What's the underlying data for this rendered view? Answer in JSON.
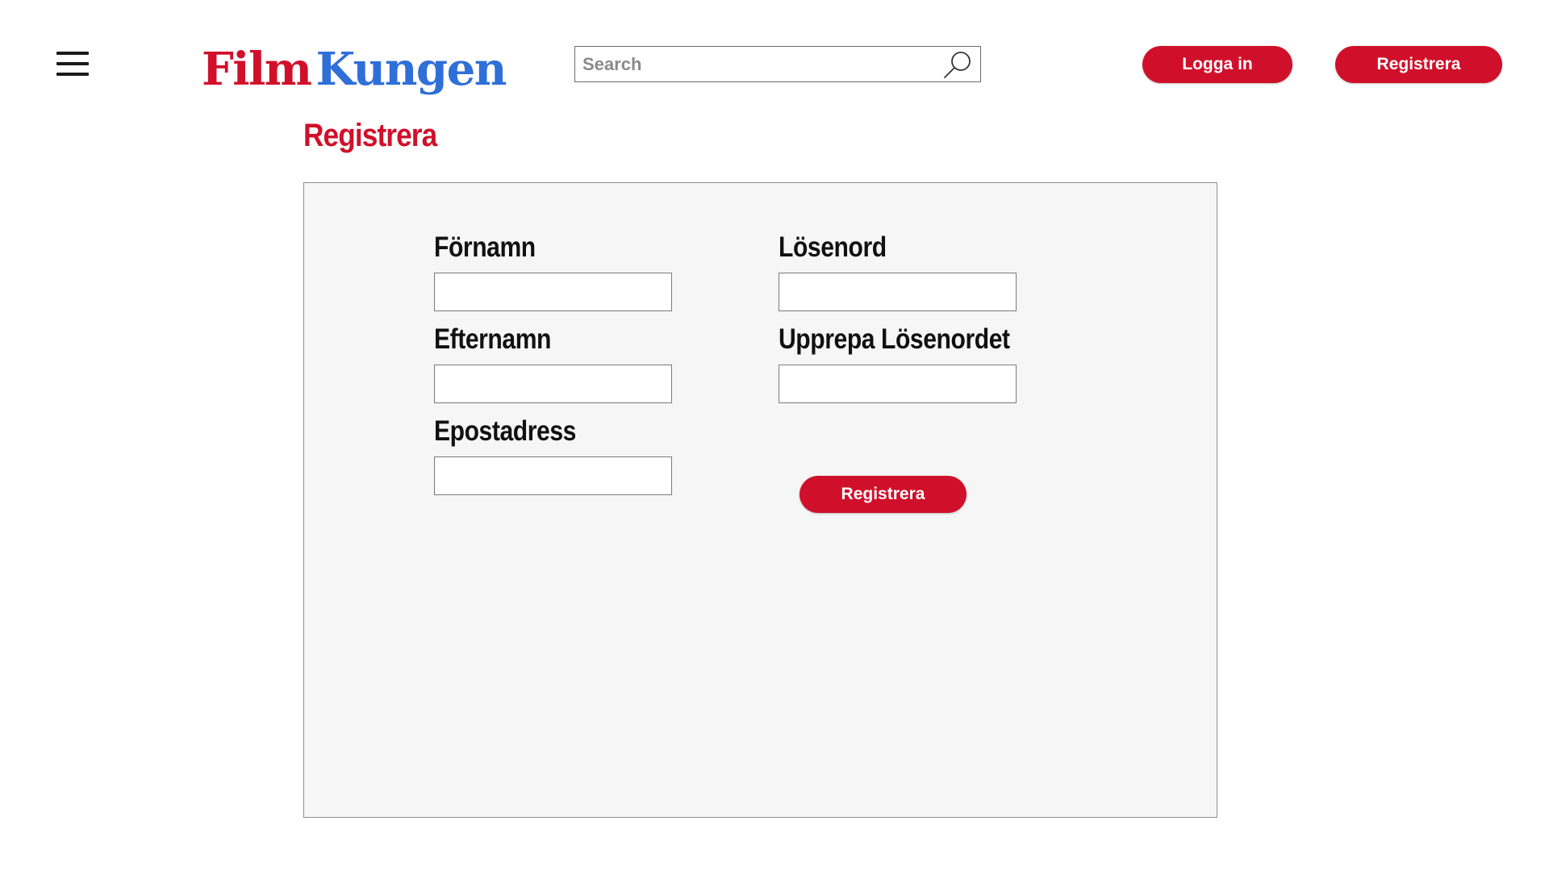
{
  "header": {
    "menu_icon": "hamburger-menu-icon",
    "logo": {
      "part1": "Film",
      "part2": "Kungen"
    },
    "search": {
      "placeholder": "Search",
      "value": "",
      "icon": "search-icon"
    },
    "login_label": "Logga in",
    "register_label": "Registrera"
  },
  "page": {
    "title": "Registrera"
  },
  "form": {
    "first_name": {
      "label": "Förnamn",
      "value": ""
    },
    "last_name": {
      "label": "Efternamn",
      "value": ""
    },
    "email": {
      "label": "Epostadress",
      "value": ""
    },
    "password": {
      "label": "Lösenord",
      "value": ""
    },
    "repeat_password": {
      "label": "Upprepa Lösenordet",
      "value": ""
    },
    "submit_label": "Registrera"
  },
  "colors": {
    "brand_red": "#d0102a",
    "brand_blue": "#2f6fd8",
    "panel_bg": "#f6f6f6"
  }
}
